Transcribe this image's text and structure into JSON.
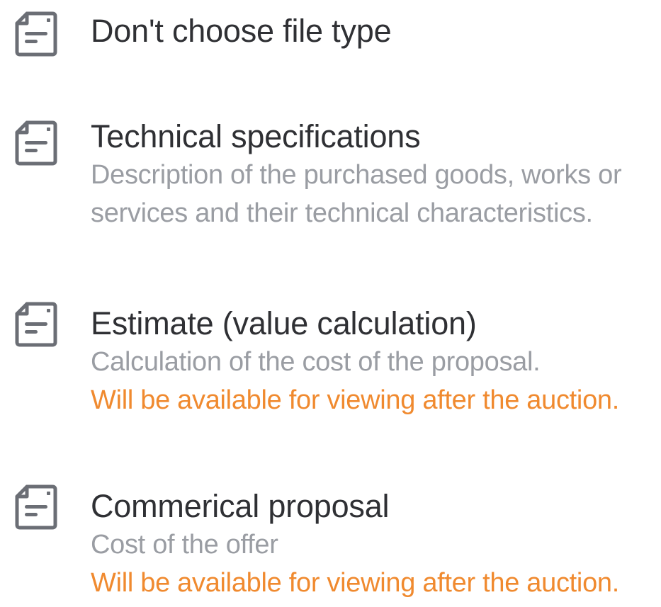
{
  "file_types": [
    {
      "icon": "document-icon",
      "title": "Don't choose file type"
    },
    {
      "icon": "document-icon",
      "title": "Technical specifications",
      "description_lines": [
        "Description of the purchased goods, works or",
        "services and their technical characteristics."
      ]
    },
    {
      "icon": "document-icon",
      "title": "Estimate (value calculation)",
      "description_lines": [
        "Calculation of the cost of the proposal."
      ],
      "warning": "Will be available for viewing after the auction."
    },
    {
      "icon": "document-icon",
      "title": "Commerical proposal",
      "description_lines": [
        "Cost of the offer"
      ],
      "warning": "Will be available for viewing after the auction."
    }
  ],
  "colors": {
    "icon": "#6b6e75",
    "title": "#2f3034",
    "description": "#9a9da3",
    "warning": "#f08a2f"
  }
}
